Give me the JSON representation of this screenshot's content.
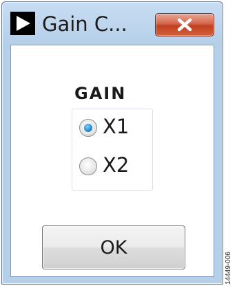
{
  "window": {
    "title": "Gain C...",
    "app_icon": "play-triangle-icon",
    "close_icon": "close-icon"
  },
  "gain": {
    "label": "GAIN",
    "options": [
      {
        "label": "X1",
        "selected": true
      },
      {
        "label": "X2",
        "selected": false
      }
    ]
  },
  "ok_button": {
    "label": "OK"
  },
  "figure_id": "14449-006",
  "colors": {
    "frame": "#b6d0ea",
    "close_button": "#c2401f",
    "radio_selected": "#2a8fd0"
  }
}
